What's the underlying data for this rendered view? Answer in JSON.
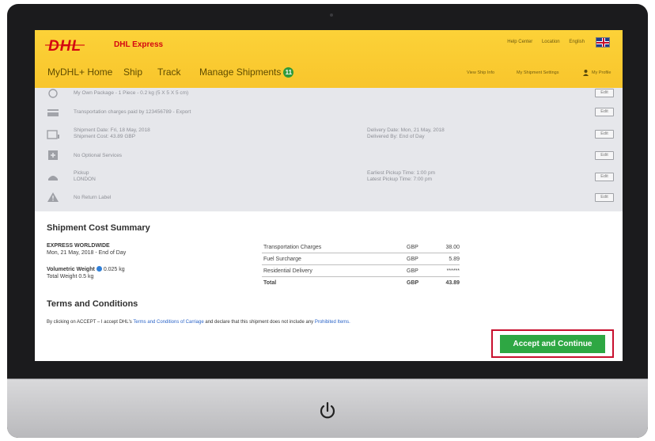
{
  "header": {
    "brand": "DHL",
    "brand_sub": "DHL Express",
    "top_links": [
      "Help Center",
      "Location",
      "English"
    ],
    "nav": {
      "home": "MyDHL+ Home",
      "ship": "Ship",
      "track": "Track",
      "manage": "Manage Shipments",
      "manage_badge": "11",
      "right_links": [
        "View Ship Info",
        "My Shipment Settings",
        "My Profile"
      ]
    }
  },
  "summary_rows": [
    {
      "icon": "package-icon",
      "text": "My Own Package - 1 Piece - 0.2 kg (5 X 5 X 5 cm)",
      "text2": "",
      "edit": "Edit"
    },
    {
      "icon": "payment-icon",
      "text": "Transportation charges paid by 123456789 - Export",
      "text2": "",
      "edit": "Edit"
    },
    {
      "icon": "calendar-icon",
      "text": "Shipment Date: Fri, 18 May, 2018\nShipment Cost: 43.89 GBP",
      "text2": "Delivery Date: Mon, 21 May, 2018\nDelivered By: End of Day",
      "edit": "Edit"
    },
    {
      "icon": "plus-icon",
      "text": "No Optional Services",
      "text2": "",
      "edit": "Edit"
    },
    {
      "icon": "courier-icon",
      "text": "Pickup\nLONDON",
      "text2": "Earliest Pickup Time: 1:00 pm\nLatest Pickup Time: 7:00 pm",
      "edit": "Edit"
    },
    {
      "icon": "warning-icon",
      "text": "No Return Label",
      "text2": "",
      "edit": "Edit"
    }
  ],
  "cost_summary": {
    "title": "Shipment Cost Summary",
    "service": "EXPRESS WORLDWIDE",
    "delivery": "Mon, 21 May, 2018 - End of Day",
    "volumetric_label": "Volumetric Weight",
    "volumetric_value": "0.025 kg",
    "total_weight": "Total Weight 0.5 kg",
    "charges": [
      {
        "label": "Transportation Charges",
        "currency": "GBP",
        "amount": "38.00"
      },
      {
        "label": "Fuel Surcharge",
        "currency": "GBP",
        "amount": "5.89"
      },
      {
        "label": "Residential Delivery",
        "currency": "GBP",
        "amount": "******"
      }
    ],
    "total": {
      "label": "Total",
      "currency": "GBP",
      "amount": "43.89"
    }
  },
  "terms": {
    "title": "Terms and Conditions",
    "text_before": "By clicking on ACCEPT – I accept DHL's",
    "link1": "Terms and Conditions of Carriage",
    "text_middle": "and declare that this shipment does not include any",
    "link2": "Prohibited Items."
  },
  "accept_button": "Accept and Continue",
  "colors": {
    "dhl_yellow": "#FCCC34",
    "dhl_red": "#D40511",
    "accept_green": "#2EA743",
    "highlight_red": "#C8102E"
  }
}
